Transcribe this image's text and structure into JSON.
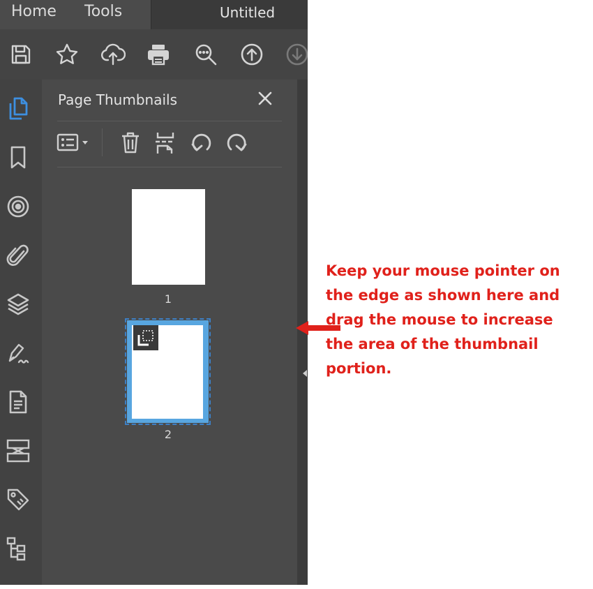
{
  "topbar": {
    "tabs": [
      {
        "label": "Home"
      },
      {
        "label": "Tools"
      }
    ],
    "doc_title": "Untitled"
  },
  "toolbar": {
    "buttons": [
      {
        "icon": "save-icon"
      },
      {
        "icon": "star-icon"
      },
      {
        "icon": "cloud-upload-icon"
      },
      {
        "icon": "print-icon"
      },
      {
        "icon": "zoom-icon"
      },
      {
        "icon": "page-up-icon"
      },
      {
        "icon": "page-down-icon"
      }
    ]
  },
  "left_rail": {
    "items": [
      {
        "icon": "page-thumbnails-icon",
        "active": true
      },
      {
        "icon": "bookmark-icon"
      },
      {
        "icon": "target-icon"
      },
      {
        "icon": "attachment-icon"
      },
      {
        "icon": "layers-icon"
      },
      {
        "icon": "signature-icon"
      },
      {
        "icon": "document-icon"
      },
      {
        "icon": "compare-icon"
      },
      {
        "icon": "tag-icon"
      },
      {
        "icon": "structure-icon"
      }
    ]
  },
  "panel": {
    "title": "Page Thumbnails",
    "tools": [
      {
        "icon": "options-dropdown-icon"
      },
      {
        "icon": "delete-icon"
      },
      {
        "icon": "extract-icon"
      },
      {
        "icon": "rotate-left-icon"
      },
      {
        "icon": "rotate-right-icon"
      }
    ],
    "thumbnails": [
      {
        "page": "1"
      },
      {
        "page": "2",
        "selected": true
      }
    ]
  },
  "annotation": {
    "text": "Keep your mouse pointer on the edge as shown here and drag the mouse to increase the area of the thumbnail portion.",
    "color": "#e0211b"
  },
  "colors": {
    "accent": "#3d8fe0",
    "selection": "#58a6e0"
  }
}
